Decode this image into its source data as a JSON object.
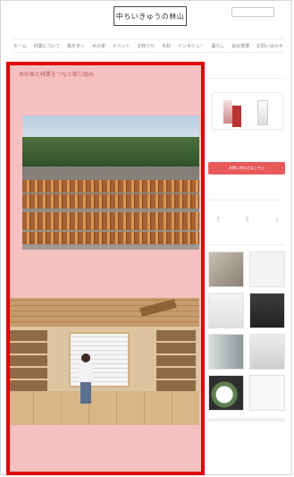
{
  "header": {
    "logo_text": "中ちいきゅうの林山",
    "tagline": "",
    "search_placeholder": "",
    "nav": [
      "ホーム",
      "林業について",
      "森を歩く",
      "木の家",
      "イベント",
      "お知らせ",
      "木材",
      "インタビュー",
      "暮らし",
      "会社概要",
      "お問い合わせ"
    ]
  },
  "article": {
    "title": "木の家と林業をつなぐ取り組み",
    "meta": "",
    "paragraph_1": "",
    "paragraph_2": "",
    "paragraph_3": "",
    "paragraph_4": ""
  },
  "sidebar": {
    "widget_1_title": "",
    "cta_label": "お問い合わせはこちら",
    "widget_2_title": "",
    "social": [
      "f",
      "t",
      "i"
    ],
    "widget_3_title": "",
    "list_items": [
      "",
      "",
      "",
      ""
    ]
  },
  "highlight_color": "#e00000"
}
